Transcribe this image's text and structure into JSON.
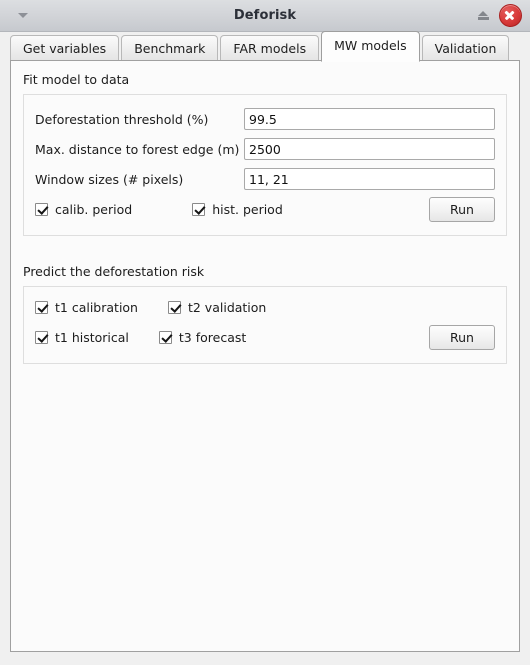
{
  "window": {
    "title": "Deforisk",
    "menu_icon": "chevron-down-icon",
    "shade_icon": "window-shade-icon",
    "close_icon": "close-icon"
  },
  "tabs": [
    {
      "label": "Get variables",
      "active": false
    },
    {
      "label": "Benchmark",
      "active": false
    },
    {
      "label": "FAR models",
      "active": false
    },
    {
      "label": "MW models",
      "active": true
    },
    {
      "label": "Validation",
      "active": false
    }
  ],
  "fit_section": {
    "title": "Fit model to data",
    "fields": [
      {
        "label": "Deforestation threshold (%)",
        "value": "99.5"
      },
      {
        "label": "Max. distance to forest edge (m)",
        "value": "2500"
      },
      {
        "label": "Window sizes (# pixels)",
        "value": "11, 21"
      }
    ],
    "checkboxes": [
      {
        "label": "calib. period",
        "checked": true
      },
      {
        "label": "hist. period",
        "checked": true
      }
    ],
    "run_label": "Run"
  },
  "predict_section": {
    "title": "Predict the deforestation risk",
    "checkboxes": [
      {
        "label": "t1 calibration",
        "checked": true
      },
      {
        "label": "t2 validation",
        "checked": true
      },
      {
        "label": "t1 historical",
        "checked": true
      },
      {
        "label": "t3 forecast",
        "checked": true
      }
    ],
    "run_label": "Run"
  },
  "colors": {
    "close_button": "#d83a3a",
    "titlebar": "#d3d5d9",
    "panel_background": "#fbfbfb",
    "window_background": "#f0f0f0"
  }
}
